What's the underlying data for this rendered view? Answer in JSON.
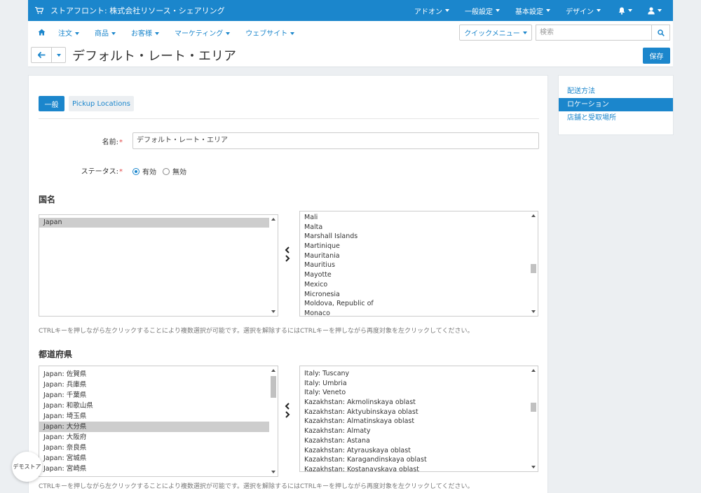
{
  "topbar": {
    "store_title": "ストアフロント: 株式会社リソース・シェアリング",
    "menu": [
      "アドオン",
      "一般設定",
      "基本設定",
      "デザイン"
    ]
  },
  "nav": {
    "items": [
      "注文",
      "商品",
      "お客様",
      "マーケティング",
      "ウェブサイト"
    ],
    "quick_menu": "クイックメニュー",
    "search_placeholder": "検索"
  },
  "page": {
    "title": "デフォルト・レート・エリア",
    "save_label": "保存"
  },
  "tabs": [
    "一般",
    "Pickup Locations"
  ],
  "form": {
    "name_label": "名前:",
    "name_value": "デフォルト・レート・エリア",
    "status_label": "ステータス:",
    "status_on": "有効",
    "status_off": "無効",
    "status_selected": "有効",
    "required_mark": "*"
  },
  "countries": {
    "title": "国名",
    "selected": [
      "Japan"
    ],
    "available": [
      "Mali",
      "Malta",
      "Marshall Islands",
      "Martinique",
      "Mauritania",
      "Mauritius",
      "Mayotte",
      "Mexico",
      "Micronesia",
      "Moldova, Republic of",
      "Monaco"
    ],
    "hint": "CTRLキーを押しながら左クリックすることにより複数選択が可能です。選択を解除するにはCTRLキーを押しながら再度対象を左クリックしてください。"
  },
  "states": {
    "title": "都道府県",
    "selected": [
      "Japan: 佐賀県",
      "Japan: 兵庫県",
      "Japan: 千葉県",
      "Japan: 和歌山県",
      "Japan: 埼玉県",
      "Japan: 大分県",
      "Japan: 大阪府",
      "Japan: 奈良県",
      "Japan: 宮城県",
      "Japan: 宮崎県"
    ],
    "highlighted": "Japan: 大分県",
    "available": [
      "Italy: Tuscany",
      "Italy: Umbria",
      "Italy: Veneto",
      "Kazakhstan: Akmolinskaya oblast",
      "Kazakhstan: Aktyubinskaya oblast",
      "Kazakhstan: Almatinskaya oblast",
      "Kazakhstan: Almaty",
      "Kazakhstan: Astana",
      "Kazakhstan: Atyrauskaya oblast",
      "Kazakhstan: Karagandinskaya oblast",
      "Kazakhstan: Kostanayskaya oblast"
    ],
    "hint": "CTRLキーを押しながら左クリックすることにより複数選択が可能です。選択を解除するにはCTRLキーを押しながら再度対象を左クリックしてください。"
  },
  "sidebar": {
    "items": [
      "配送方法",
      "ロケーション",
      "店舗と受取場所"
    ],
    "active": "ロケーション"
  },
  "demo_badge": "デモストア",
  "colors": {
    "accent": "#1b86cc",
    "background": "#eceff2",
    "required": "#e04848"
  }
}
